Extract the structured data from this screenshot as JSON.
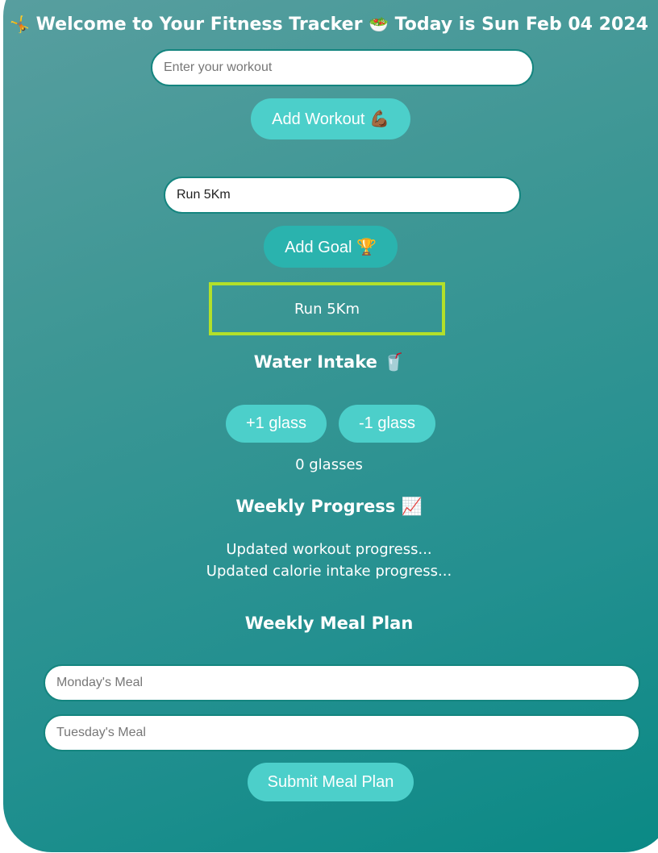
{
  "header": {
    "lead_emoji": "🤸",
    "welcome_text": "Welcome to Your Fitness Tracker",
    "mid_emoji": "🥗",
    "date_text": "Today is Sun Feb 04 2024"
  },
  "workout": {
    "input_placeholder": "Enter your workout",
    "add_button_label": "Add Workout 💪🏾"
  },
  "goal": {
    "input_value": "Run 5Km",
    "add_button_label": "Add Goal 🏆",
    "current_goal": "Run 5Km"
  },
  "water": {
    "heading": "Water Intake 🥤",
    "plus_label": "+1 glass",
    "minus_label": "-1 glass",
    "count_text": "0 glasses"
  },
  "progress": {
    "heading": "Weekly Progress 📈",
    "lines": [
      "Updated workout progress...",
      "Updated calorie intake progress..."
    ]
  },
  "meal_plan": {
    "heading": "Weekly Meal Plan",
    "monday_placeholder": "Monday's Meal",
    "tuesday_placeholder": "Tuesday's Meal",
    "submit_label": "Submit Meal Plan"
  },
  "colors": {
    "gradient_start": "#5a9fa0",
    "gradient_end": "#0a8985",
    "button": "#4ccfca",
    "goal_border": "#b2e02a"
  }
}
